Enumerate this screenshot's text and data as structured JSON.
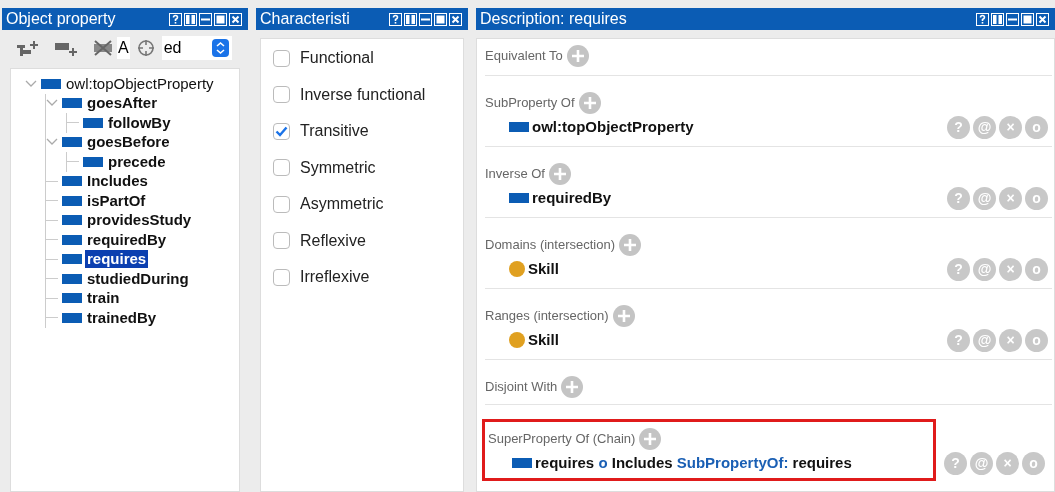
{
  "left_panel": {
    "title": "Object property",
    "toolbar": {
      "text_fragment": "A",
      "dropdown_value": "ed"
    },
    "tree": [
      {
        "label": "owl:topObjectProperty",
        "bold": false,
        "selected": false,
        "expanded": true,
        "children": [
          {
            "label": "goesAfter",
            "bold": true,
            "selected": false,
            "expanded": true,
            "children": [
              {
                "label": "followBy",
                "bold": true,
                "selected": false
              }
            ]
          },
          {
            "label": "goesBefore",
            "bold": true,
            "selected": false,
            "expanded": true,
            "children": [
              {
                "label": "precede",
                "bold": true,
                "selected": false
              }
            ]
          },
          {
            "label": "Includes",
            "bold": true,
            "selected": false
          },
          {
            "label": "isPartOf",
            "bold": true,
            "selected": false
          },
          {
            "label": "providesStudy",
            "bold": true,
            "selected": false
          },
          {
            "label": "requiredBy",
            "bold": true,
            "selected": false
          },
          {
            "label": "requires",
            "bold": true,
            "selected": true
          },
          {
            "label": "studiedDuring",
            "bold": true,
            "selected": false
          },
          {
            "label": "train",
            "bold": true,
            "selected": false
          },
          {
            "label": "trainedBy",
            "bold": true,
            "selected": false
          }
        ]
      }
    ]
  },
  "middle_panel": {
    "title": "Characteristi",
    "characteristics": [
      {
        "label": "Functional",
        "checked": false
      },
      {
        "label": "Inverse functional",
        "checked": false
      },
      {
        "label": "Transitive",
        "checked": true
      },
      {
        "label": "Symmetric",
        "checked": false
      },
      {
        "label": "Asymmetric",
        "checked": false
      },
      {
        "label": "Reflexive",
        "checked": false
      },
      {
        "label": "Irreflexive",
        "checked": false
      }
    ]
  },
  "right_panel": {
    "title": "Description: requires",
    "sections": [
      {
        "label": "Equivalent To",
        "highlighted": false
      },
      {
        "label": "SubProperty Of",
        "highlighted": false,
        "items": [
          {
            "kind": "property",
            "segments": [
              {
                "text": "owl:topObjectProperty",
                "kind": "name"
              }
            ],
            "actions": [
              "?",
              "@",
              "×",
              "o"
            ]
          }
        ]
      },
      {
        "label": "Inverse Of",
        "highlighted": false,
        "items": [
          {
            "kind": "property",
            "segments": [
              {
                "text": "requiredBy",
                "kind": "name"
              }
            ],
            "actions": [
              "?",
              "@",
              "×",
              "o"
            ]
          }
        ]
      },
      {
        "label": "Domains (intersection)",
        "highlighted": false,
        "items": [
          {
            "kind": "class",
            "segments": [
              {
                "text": "Skill",
                "kind": "name"
              }
            ],
            "actions": [
              "?",
              "@",
              "×",
              "o"
            ]
          }
        ]
      },
      {
        "label": "Ranges (intersection)",
        "highlighted": false,
        "items": [
          {
            "kind": "class",
            "segments": [
              {
                "text": "Skill",
                "kind": "name"
              }
            ],
            "actions": [
              "?",
              "@",
              "×",
              "o"
            ]
          }
        ]
      },
      {
        "label": "Disjoint With",
        "highlighted": false
      },
      {
        "label": "SuperProperty Of (Chain)",
        "highlighted": true,
        "items": [
          {
            "kind": "property",
            "segments": [
              {
                "text": "requires",
                "kind": "name"
              },
              {
                "text": "o",
                "kind": "keyword"
              },
              {
                "text": "Includes",
                "kind": "name"
              },
              {
                "text": "SubPropertyOf:",
                "kind": "keyword"
              },
              {
                "text": "requires",
                "kind": "name"
              }
            ],
            "actions": [
              "?",
              "@",
              "×",
              "o"
            ]
          }
        ]
      }
    ]
  }
}
